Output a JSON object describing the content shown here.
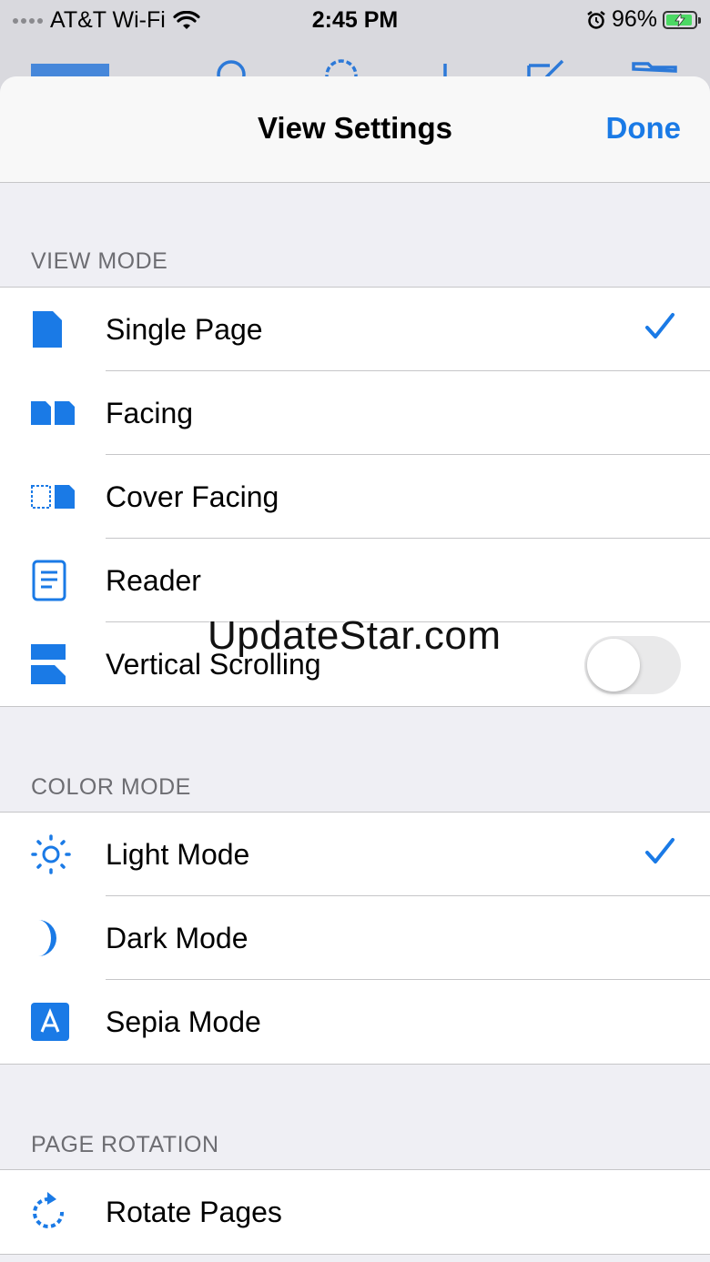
{
  "status_bar": {
    "carrier": "AT&T Wi-Fi",
    "time": "2:45 PM",
    "battery": "96%",
    "icons": [
      "signal-dots-icon",
      "wifi-icon",
      "alarm-icon",
      "battery-charging-icon"
    ]
  },
  "nav": {
    "title": "View Settings",
    "done_label": "Done"
  },
  "sections": {
    "view_mode": {
      "header": "VIEW MODE",
      "items": [
        {
          "label": "Single Page",
          "icon": "single-page-icon",
          "checked": true
        },
        {
          "label": "Facing",
          "icon": "facing-pages-icon"
        },
        {
          "label": "Cover Facing",
          "icon": "cover-facing-icon"
        },
        {
          "label": "Reader",
          "icon": "reader-icon"
        },
        {
          "label": "Vertical Scrolling",
          "icon": "vertical-scrolling-icon",
          "toggle": false
        }
      ]
    },
    "color_mode": {
      "header": "COLOR MODE",
      "items": [
        {
          "label": "Light Mode",
          "icon": "sun-icon",
          "checked": true
        },
        {
          "label": "Dark Mode",
          "icon": "moon-icon"
        },
        {
          "label": "Sepia Mode",
          "icon": "sepia-a-icon"
        }
      ]
    },
    "page_rotation": {
      "header": "PAGE ROTATION",
      "items": [
        {
          "label": "Rotate Pages",
          "icon": "rotate-icon"
        }
      ]
    }
  },
  "watermark": "UpdateStar.com",
  "colors": {
    "accent": "#1a7ae6",
    "background": "#efeff4",
    "separator": "#c6c6c8"
  }
}
